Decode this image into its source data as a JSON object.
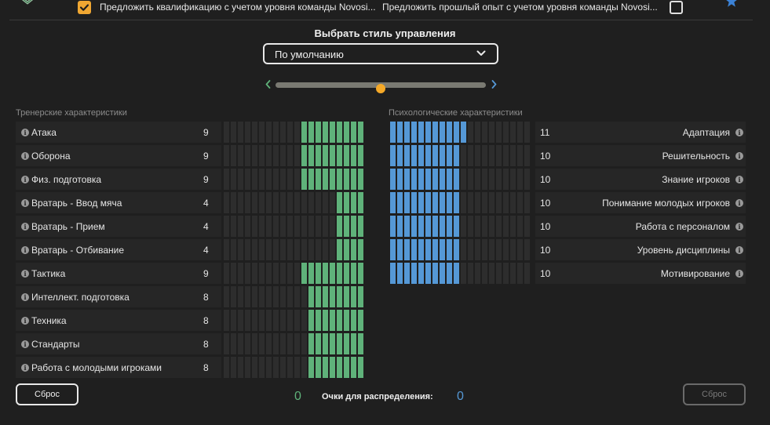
{
  "top": {
    "option1": {
      "checked": true,
      "label": "Предложить квалификацию с учетом уровня команды Novosi..."
    },
    "option2": {
      "checked": false,
      "label": "Предложить прошлый опыт с учетом уровня команды Novosi..."
    }
  },
  "style_selector": {
    "title": "Выбрать стиль управления",
    "selected": "По умолчанию",
    "slider_fraction": 0.5
  },
  "coaching": {
    "title": "Тренерские характеристики",
    "max": 20,
    "items": [
      {
        "label": "Атака",
        "value": "9"
      },
      {
        "label": "Оборона",
        "value": "9"
      },
      {
        "label": "Физ. подготовка",
        "value": "9"
      },
      {
        "label": "Вратарь - Ввод мяча",
        "value": "4"
      },
      {
        "label": "Вратарь - Прием",
        "value": "4"
      },
      {
        "label": "Вратарь - Отбивание",
        "value": "4"
      },
      {
        "label": "Тактика",
        "value": "9"
      },
      {
        "label": "Интеллект. подготовка",
        "value": "8"
      },
      {
        "label": "Техника",
        "value": "8"
      },
      {
        "label": "Стандарты",
        "value": "8"
      },
      {
        "label": "Работа с молодыми игроками",
        "value": "8"
      }
    ]
  },
  "psych": {
    "title": "Психологические характеристики",
    "max": 20,
    "items": [
      {
        "label": "Адаптация",
        "value": "11"
      },
      {
        "label": "Решительность",
        "value": "10"
      },
      {
        "label": "Знание игроков",
        "value": "10"
      },
      {
        "label": "Понимание молодых игроков",
        "value": "10"
      },
      {
        "label": "Работа с персоналом",
        "value": "10"
      },
      {
        "label": "Уровень дисциплины",
        "value": "10"
      },
      {
        "label": "Мотивирование",
        "value": "10"
      }
    ]
  },
  "bottom": {
    "reset_left": "Сброс",
    "reset_right": "Сброс",
    "points_left": "0",
    "points_label": "Очки для распределения:",
    "points_right": "0"
  },
  "colors": {
    "accent": "#f0a732",
    "coaching_bar": "#5fb27a",
    "psych_bar": "#5598d6",
    "empty_bar": "#2d2d2d"
  },
  "icons": {
    "checkbox_checked": "checkmark-icon",
    "dropdown": "chevron-down-icon",
    "slider_left": "chevron-left-icon",
    "slider_right": "chevron-right-icon",
    "info": "info-icon",
    "favorite": "star-icon"
  }
}
